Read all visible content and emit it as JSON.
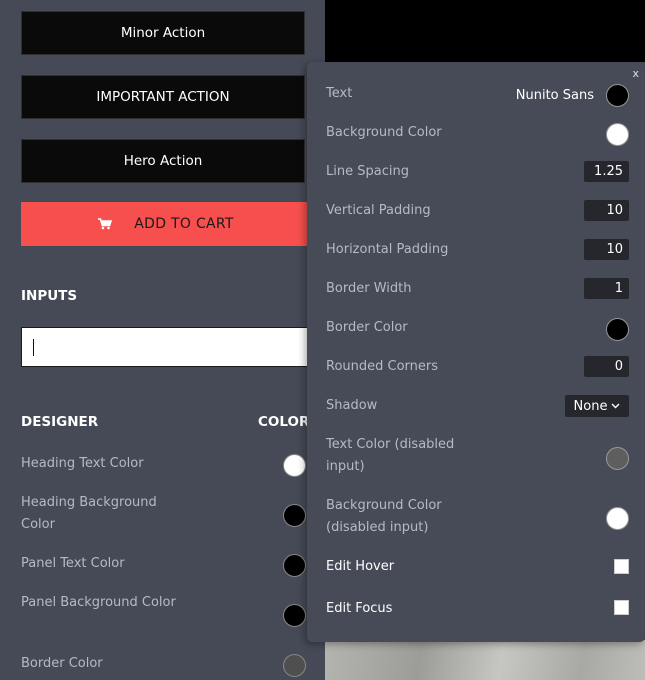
{
  "left": {
    "buttons": [
      "Minor Action",
      "IMPORTANT ACTION",
      "Hero Action"
    ],
    "cart_label": "ADD TO CART",
    "inputs_heading": "INPUTS",
    "input_value": "",
    "designer_heading": "DESIGNER",
    "color_heading": "COLOR",
    "designer_rows": [
      {
        "label": "Heading Text Color",
        "color": "#ffffff"
      },
      {
        "label": "Heading Background Color",
        "color": "#000000"
      },
      {
        "label": "Panel Text Color",
        "color": "#000000"
      },
      {
        "label": "Panel Background Color",
        "color": "#000000"
      },
      {
        "label": "Border Color",
        "color": "#4f4f4f"
      }
    ]
  },
  "popup": {
    "close": "x",
    "text_label": "Text",
    "font": "Nunito Sans",
    "text_color": "#000000",
    "bg_label": "Background Color",
    "bg_color": "#ffffff",
    "line_spacing_label": "Line Spacing",
    "line_spacing": "1.25",
    "vpad_label": "Vertical Padding",
    "vpad": "10",
    "hpad_label": "Horizontal Padding",
    "hpad": "10",
    "border_width_label": "Border Width",
    "border_width": "1",
    "border_color_label": "Border Color",
    "border_color": "#000000",
    "rounded_label": "Rounded Corners",
    "rounded": "0",
    "shadow_label": "Shadow",
    "shadow": "None",
    "disabled_text_label": "Text Color (disabled input)",
    "disabled_text_color": "#5e5e5e",
    "disabled_bg_label": "Background Color (disabled input)",
    "disabled_bg_color": "#ffffff",
    "edit_hover_label": "Edit Hover",
    "edit_focus_label": "Edit Focus"
  }
}
